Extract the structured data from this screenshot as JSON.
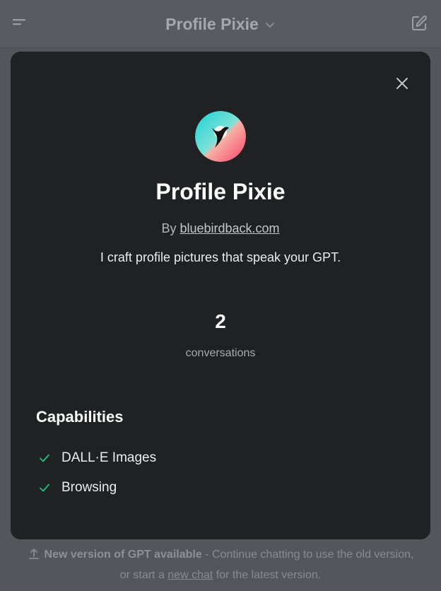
{
  "header": {
    "title": "Profile Pixie",
    "menu_icon": "menu-icon",
    "chevron_icon": "chevron-down-icon",
    "edit_icon": "new-chat-icon"
  },
  "modal": {
    "name": "Profile Pixie",
    "by_prefix": "By",
    "author": "bluebirdback.com",
    "description": "I craft profile pictures that speak your GPT.",
    "conversations_count": "2",
    "conversations_label": "conversations",
    "capabilities_title": "Capabilities",
    "capabilities": [
      {
        "label": "DALL·E Images"
      },
      {
        "label": "Browsing"
      }
    ],
    "close_icon": "close-icon",
    "check_color": "#19c37d"
  },
  "notice": {
    "strong": "New version of GPT available",
    "rest": " - Continue chatting to use the old version,",
    "line2_prefix": "or start a ",
    "link": "new chat",
    "line2_suffix": " for the latest version."
  }
}
